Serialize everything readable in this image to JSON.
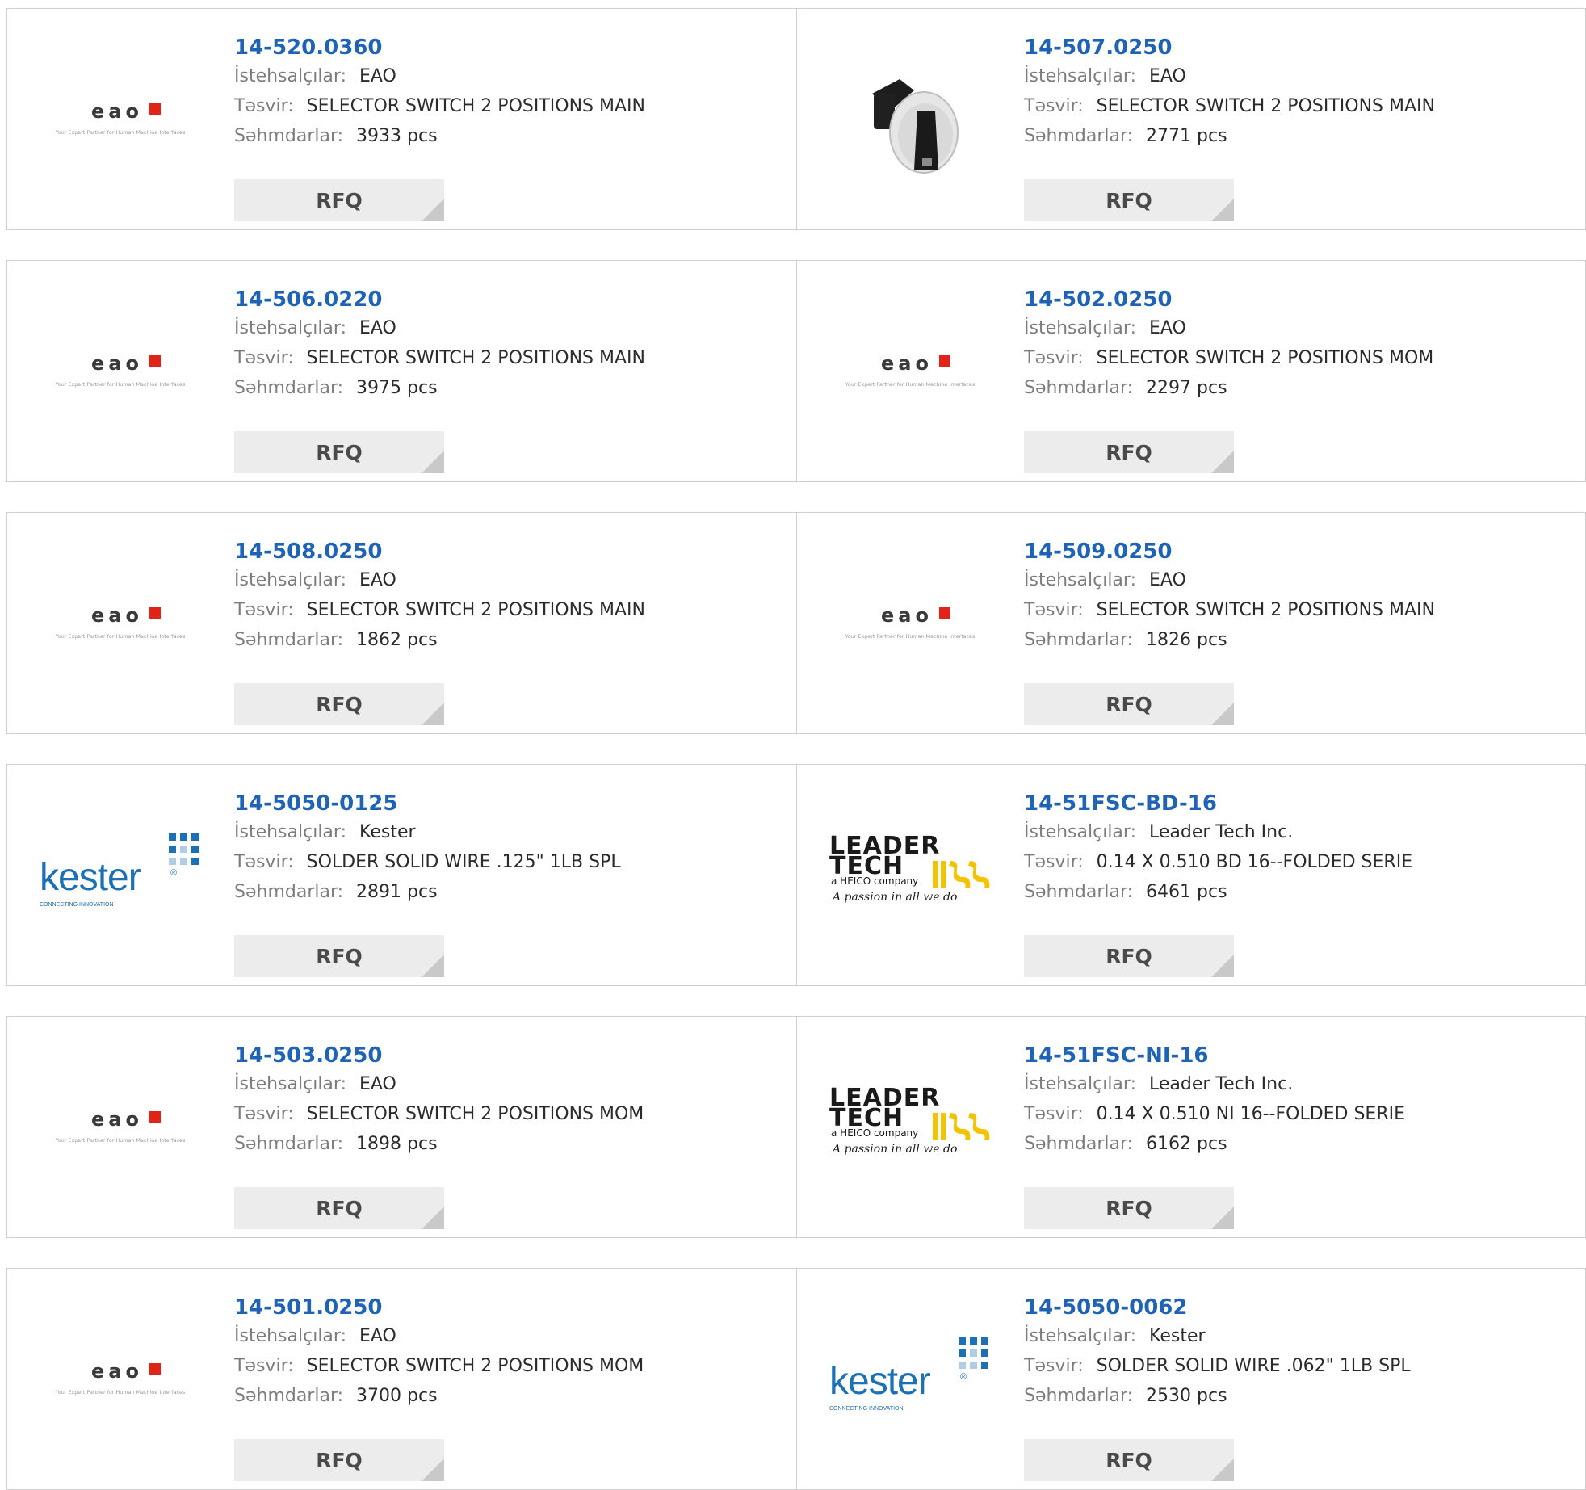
{
  "labels": {
    "manufacturer": "İstehsalçılar:",
    "description": "Təsvir:",
    "stock": "Səhmdarlar:",
    "rfq": "RFQ"
  },
  "logos": {
    "eao": {
      "text": "eao",
      "tagline": "Your Expert Partner for Human Machine Interfaces",
      "accent": "#e2231a"
    },
    "kester": {
      "text": "kester",
      "tagline": "CONNECTING INNOVATION",
      "accent": "#1c70b5"
    },
    "leadertech": {
      "line1": "LEADER",
      "line2": "TECH",
      "line3": "a HEICO company",
      "slogan": "A passion in all we do",
      "accent": "#f3c300"
    }
  },
  "colors": {
    "part_link": "#1e63b5",
    "button_bg": "#ececec",
    "border": "#cfcfcf"
  },
  "products": [
    {
      "part": "14-520.0360",
      "manufacturer": "EAO",
      "description": "SELECTOR SWITCH 2 POSITIONS MAIN",
      "stock": "3933 pcs",
      "image": "eao-logo"
    },
    {
      "part": "14-507.0250",
      "manufacturer": "EAO",
      "description": "SELECTOR SWITCH 2 POSITIONS MAIN",
      "stock": "2771 pcs",
      "image": "selector-switch-photo"
    },
    {
      "part": "14-506.0220",
      "manufacturer": "EAO",
      "description": "SELECTOR SWITCH 2 POSITIONS MAIN",
      "stock": "3975 pcs",
      "image": "eao-logo"
    },
    {
      "part": "14-502.0250",
      "manufacturer": "EAO",
      "description": "SELECTOR SWITCH 2 POSITIONS MOM",
      "stock": "2297 pcs",
      "image": "eao-logo"
    },
    {
      "part": "14-508.0250",
      "manufacturer": "EAO",
      "description": "SELECTOR SWITCH 2 POSITIONS MAIN",
      "stock": "1862 pcs",
      "image": "eao-logo"
    },
    {
      "part": "14-509.0250",
      "manufacturer": "EAO",
      "description": "SELECTOR SWITCH 2 POSITIONS MAIN",
      "stock": "1826 pcs",
      "image": "eao-logo"
    },
    {
      "part": "14-5050-0125",
      "manufacturer": "Kester",
      "description": "SOLDER SOLID WIRE .125\" 1LB SPL",
      "stock": "2891 pcs",
      "image": "kester-logo"
    },
    {
      "part": "14-51FSC-BD-16",
      "manufacturer": "Leader Tech Inc.",
      "description": "0.14 X 0.510 BD 16--FOLDED SERIE",
      "stock": "6461 pcs",
      "image": "leadertech-logo"
    },
    {
      "part": "14-503.0250",
      "manufacturer": "EAO",
      "description": "SELECTOR SWITCH 2 POSITIONS MOM",
      "stock": "1898 pcs",
      "image": "eao-logo"
    },
    {
      "part": "14-51FSC-NI-16",
      "manufacturer": "Leader Tech Inc.",
      "description": "0.14 X 0.510 NI 16--FOLDED SERIE",
      "stock": "6162 pcs",
      "image": "leadertech-logo"
    },
    {
      "part": "14-501.0250",
      "manufacturer": "EAO",
      "description": "SELECTOR SWITCH 2 POSITIONS MOM",
      "stock": "3700 pcs",
      "image": "eao-logo"
    },
    {
      "part": "14-5050-0062",
      "manufacturer": "Kester",
      "description": "SOLDER SOLID WIRE .062\" 1LB SPL",
      "stock": "2530 pcs",
      "image": "kester-logo"
    }
  ]
}
